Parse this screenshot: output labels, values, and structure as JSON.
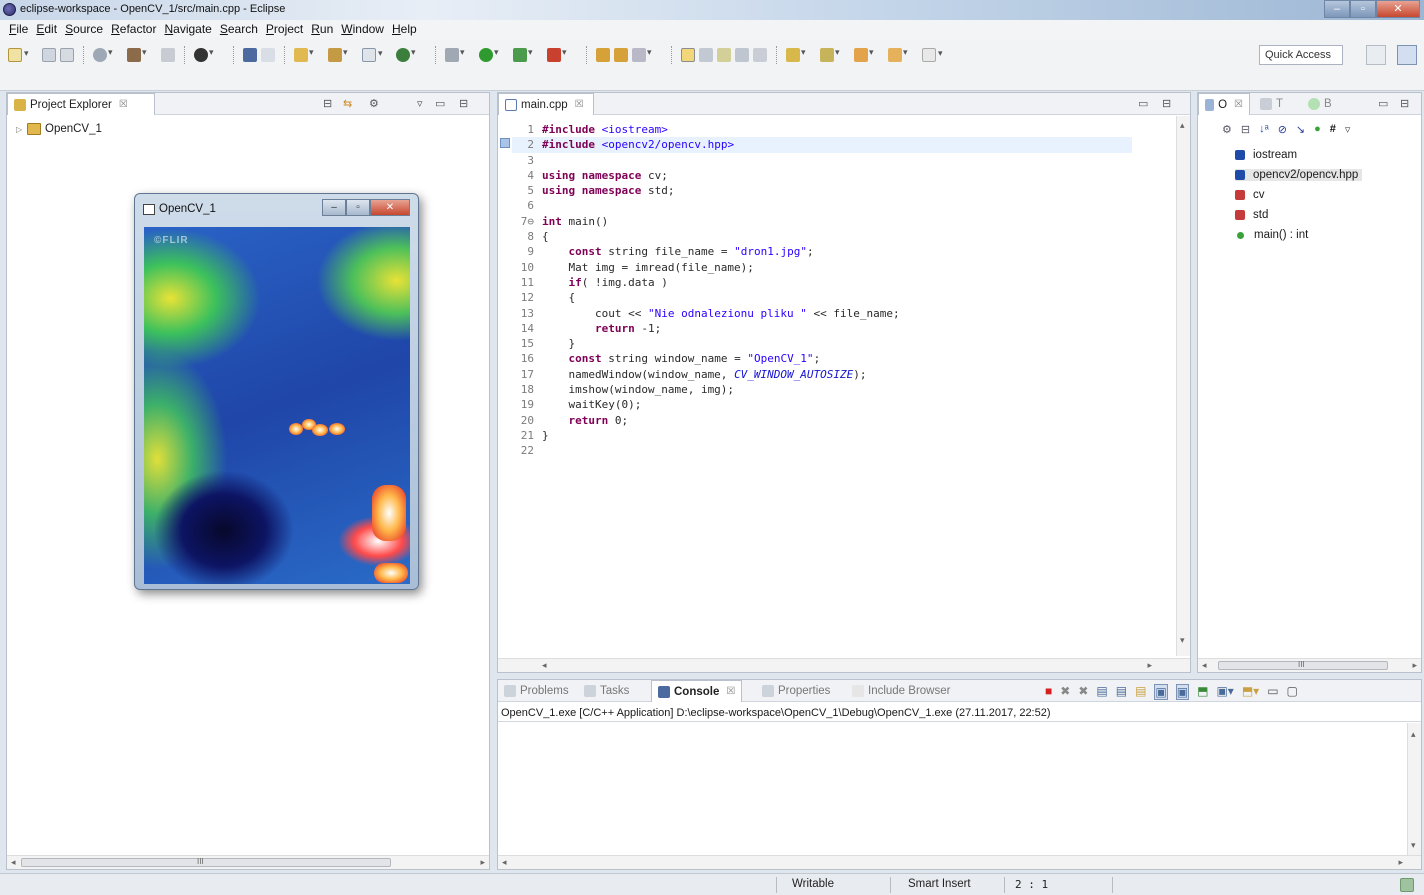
{
  "window": {
    "title": "eclipse-workspace - OpenCV_1/src/main.cpp - Eclipse"
  },
  "menu": [
    "File",
    "Edit",
    "Source",
    "Refactor",
    "Navigate",
    "Search",
    "Project",
    "Run",
    "Window",
    "Help"
  ],
  "toolbar": {
    "quick_access": "Quick Access"
  },
  "project_explorer": {
    "tab_label": "Project Explorer",
    "close_glyph": "☒",
    "tree": [
      {
        "label": "OpenCV_1",
        "expanded": false
      }
    ]
  },
  "cv_window": {
    "title": "OpenCV_1",
    "watermark": "©FLIR"
  },
  "editor": {
    "tab_label": "main.cpp",
    "close_glyph": "☒",
    "lines": [
      {
        "n": "1",
        "parts": [
          [
            "kw",
            "#include "
          ],
          [
            "str",
            "<iostream>"
          ]
        ]
      },
      {
        "n": "2",
        "parts": [
          [
            "kw",
            "#include "
          ],
          [
            "str",
            "<opencv2/opencv.hpp>"
          ]
        ],
        "highlight": true
      },
      {
        "n": "3",
        "parts": []
      },
      {
        "n": "4",
        "parts": [
          [
            "kw",
            "using namespace "
          ],
          [
            "fn",
            "cv;"
          ]
        ]
      },
      {
        "n": "5",
        "parts": [
          [
            "kw",
            "using namespace "
          ],
          [
            "fn",
            "std;"
          ]
        ]
      },
      {
        "n": "6",
        "parts": []
      },
      {
        "n": "7⊖",
        "parts": [
          [
            "kw",
            "int "
          ],
          [
            "fn",
            "main()"
          ]
        ]
      },
      {
        "n": "8",
        "parts": [
          [
            "fn",
            "{"
          ]
        ]
      },
      {
        "n": "9",
        "parts": [
          [
            "fn",
            "    "
          ],
          [
            "kw",
            "const "
          ],
          [
            "fn",
            "string file_name = "
          ],
          [
            "str",
            "\"dron1.jpg\""
          ],
          [
            "fn",
            ";"
          ]
        ]
      },
      {
        "n": "10",
        "parts": [
          [
            "fn",
            "    Mat img = imread(file_name);"
          ]
        ]
      },
      {
        "n": "11",
        "parts": [
          [
            "fn",
            "    "
          ],
          [
            "kw",
            "if"
          ],
          [
            "fn",
            "( !img.data )"
          ]
        ]
      },
      {
        "n": "12",
        "parts": [
          [
            "fn",
            "    {"
          ]
        ]
      },
      {
        "n": "13",
        "parts": [
          [
            "fn",
            "        cout << "
          ],
          [
            "str",
            "\"Nie odnalezionu pliku \""
          ],
          [
            "fn",
            " << file_name;"
          ]
        ]
      },
      {
        "n": "14",
        "parts": [
          [
            "fn",
            "        "
          ],
          [
            "kw",
            "return "
          ],
          [
            "fn",
            "-1;"
          ]
        ]
      },
      {
        "n": "15",
        "parts": [
          [
            "fn",
            "    }"
          ]
        ]
      },
      {
        "n": "16",
        "parts": [
          [
            "fn",
            "    "
          ],
          [
            "kw",
            "const "
          ],
          [
            "fn",
            "string window_name = "
          ],
          [
            "str",
            "\"OpenCV_1\""
          ],
          [
            "fn",
            ";"
          ]
        ]
      },
      {
        "n": "17",
        "parts": [
          [
            "fn",
            "    namedWindow(window_name, "
          ],
          [
            "ital",
            "CV_WINDOW_AUTOSIZE"
          ],
          [
            "fn",
            ");"
          ]
        ]
      },
      {
        "n": "18",
        "parts": [
          [
            "fn",
            "    imshow(window_name, img);"
          ]
        ]
      },
      {
        "n": "19",
        "parts": [
          [
            "fn",
            "    waitKey(0);"
          ]
        ]
      },
      {
        "n": "20",
        "parts": [
          [
            "fn",
            "    "
          ],
          [
            "kw",
            "return "
          ],
          [
            "fn",
            "0;"
          ]
        ]
      },
      {
        "n": "21",
        "parts": [
          [
            "fn",
            "}"
          ]
        ]
      },
      {
        "n": "22",
        "parts": []
      }
    ]
  },
  "outline": {
    "tabs": [
      "O",
      "T",
      "B"
    ],
    "items": [
      {
        "label": "iostream",
        "icon": "include-icon",
        "color": "#1e4aa8"
      },
      {
        "label": "opencv2/opencv.hpp",
        "icon": "include-icon",
        "color": "#1e4aa8",
        "selected": true
      },
      {
        "label": "cv",
        "icon": "using-icon",
        "color": "#c53b3b"
      },
      {
        "label": "std",
        "icon": "using-icon",
        "color": "#c53b3b"
      },
      {
        "label": "main() : int",
        "icon": "function-icon",
        "color": "#3aa23a"
      }
    ],
    "scroll_label": "III"
  },
  "bottom": {
    "tabs": [
      "Problems",
      "Tasks",
      "Console",
      "Properties",
      "Include Browser"
    ],
    "active_tab": "Console",
    "console_path": "OpenCV_1.exe [C/C++ Application] D:\\eclipse-workspace\\OpenCV_1\\Debug\\OpenCV_1.exe (27.11.2017, 22:52)"
  },
  "pe_scroll_label": "III",
  "status": {
    "writable": "Writable",
    "insert_mode": "Smart Insert",
    "position": "2 : 1"
  },
  "colors": {
    "accent": "#3b6fb6",
    "keyword": "#7f0055",
    "string": "#2a00ff"
  }
}
